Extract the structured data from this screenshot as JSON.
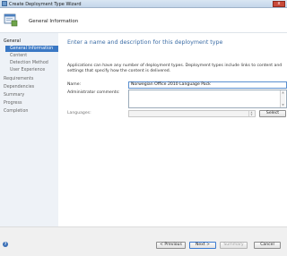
{
  "window": {
    "title": "Create Deployment Type Wizard",
    "close_glyph": "x"
  },
  "header": {
    "title": "General Information",
    "icon": "deployment-wizard-icon"
  },
  "sidebar": {
    "items": [
      {
        "label": "General",
        "level": 0,
        "state": "heading"
      },
      {
        "label": "General Information",
        "level": 1,
        "state": "selected"
      },
      {
        "label": "Content",
        "level": 1,
        "state": "normal"
      },
      {
        "label": "Detection Method",
        "level": 1,
        "state": "normal"
      },
      {
        "label": "User Experience",
        "level": 1,
        "state": "normal"
      },
      {
        "label": "Requirements",
        "level": 0,
        "state": "normal"
      },
      {
        "label": "Dependencies",
        "level": 0,
        "state": "normal"
      },
      {
        "label": "Summary",
        "level": 0,
        "state": "normal"
      },
      {
        "label": "Progress",
        "level": 0,
        "state": "normal"
      },
      {
        "label": "Completion",
        "level": 0,
        "state": "normal"
      }
    ]
  },
  "main": {
    "heading": "Enter a name and description for this deployment type",
    "description": "Applications can have any number of deployment types. Deployment types include links to content and settings that specify how the content is delivered.",
    "name_label": "Name:",
    "name_value": "Norwegian Office 2010 Language Pack",
    "comments_label": "Administrator comments:",
    "comments_value": "",
    "languages_label": "Languages:",
    "languages_value": "",
    "select_label": "Select"
  },
  "footer": {
    "help_glyph": "?",
    "previous_label": "< Previous",
    "next_label": "Next >",
    "summary_label": "Summary",
    "cancel_label": "Cancel"
  },
  "colors": {
    "accent": "#3a78c4",
    "heading": "#3d6ea6",
    "sidebar_bg": "#eef2f7"
  }
}
